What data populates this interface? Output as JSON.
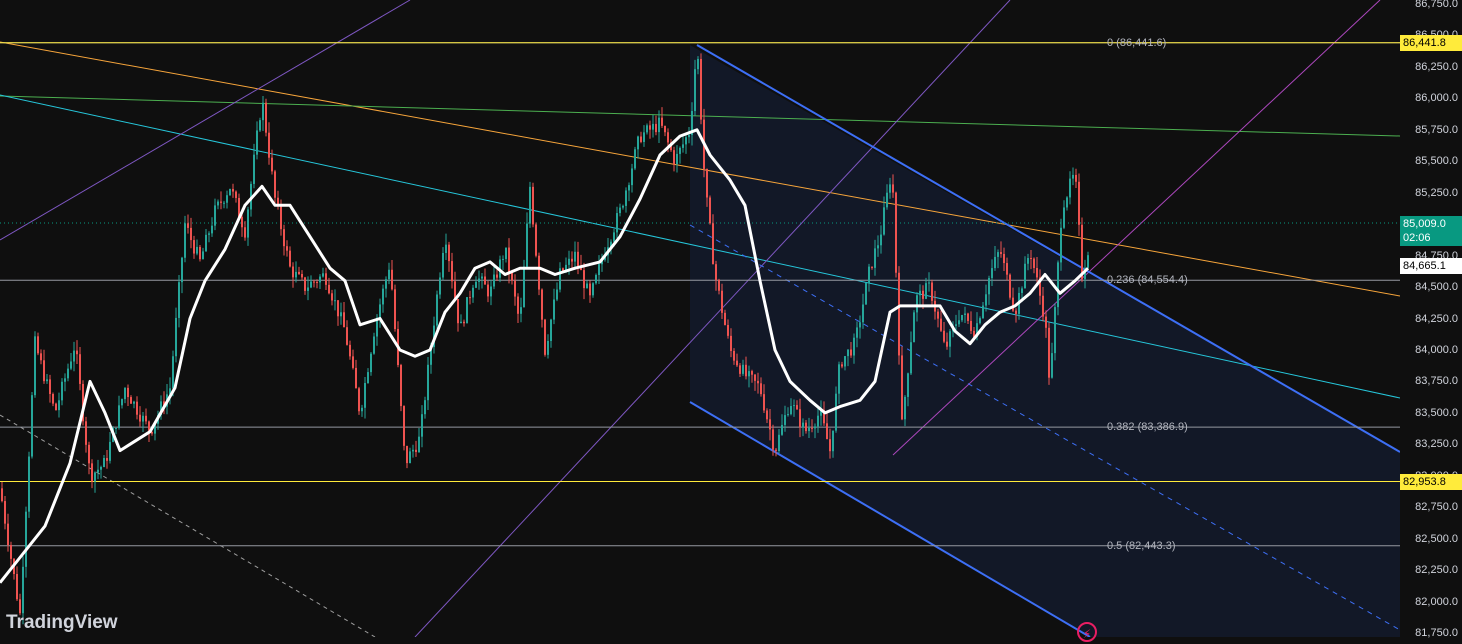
{
  "chart_data": {
    "type": "candlestick",
    "price_scale": {
      "ylim": [
        81750,
        86750
      ],
      "ticks": [
        "86,750.0",
        "86,500.0",
        "86,250.0",
        "86,000.0",
        "85,750.0",
        "85,500.0",
        "85,250.0",
        "85,000.0",
        "84,750.0",
        "84,500.0",
        "84,250.0",
        "84,000.0",
        "83,750.0",
        "83,500.0",
        "83,250.0",
        "83,000.0",
        "82,750.0",
        "82,500.0",
        "82,250.0",
        "82,000.0",
        "81,750.0"
      ]
    },
    "fib_levels": [
      {
        "label": "0 (86,441.6)",
        "value": 86441.6
      },
      {
        "label": "0.236 (84,554.4)",
        "value": 84554.4
      },
      {
        "label": "0.382 (83,386.9)",
        "value": 83386.9
      },
      {
        "label": "0.5 (82,443.3)",
        "value": 82443.3
      }
    ],
    "horizontal_lines": [
      {
        "value": 86441.8,
        "label": "86,441.8",
        "color": "#ffeb3b"
      },
      {
        "value": 82953.8,
        "label": "82,953.8",
        "color": "#ffeb3b"
      }
    ],
    "current_price": {
      "value": 85009.0,
      "label": "85,009.0",
      "countdown": "02:06",
      "color": "#089981"
    },
    "crosshair_price": {
      "value": 84665.1,
      "label": "84,665.1"
    },
    "price_path": [
      [
        0,
        82900
      ],
      [
        20,
        81900
      ],
      [
        35,
        84050
      ],
      [
        55,
        83500
      ],
      [
        75,
        84050
      ],
      [
        90,
        83000
      ],
      [
        105,
        83100
      ],
      [
        125,
        83700
      ],
      [
        150,
        83350
      ],
      [
        170,
        83700
      ],
      [
        185,
        85000
      ],
      [
        200,
        84700
      ],
      [
        215,
        85100
      ],
      [
        230,
        85300
      ],
      [
        245,
        84950
      ],
      [
        262,
        86000
      ],
      [
        275,
        85200
      ],
      [
        290,
        84650
      ],
      [
        305,
        84500
      ],
      [
        325,
        84600
      ],
      [
        345,
        84150
      ],
      [
        360,
        83500
      ],
      [
        375,
        84200
      ],
      [
        390,
        84700
      ],
      [
        405,
        83100
      ],
      [
        420,
        83300
      ],
      [
        435,
        84300
      ],
      [
        445,
        84950
      ],
      [
        460,
        84150
      ],
      [
        475,
        84600
      ],
      [
        490,
        84450
      ],
      [
        505,
        84800
      ],
      [
        520,
        84200
      ],
      [
        530,
        85300
      ],
      [
        545,
        84000
      ],
      [
        560,
        84600
      ],
      [
        575,
        84750
      ],
      [
        590,
        84400
      ],
      [
        605,
        84800
      ],
      [
        620,
        85100
      ],
      [
        640,
        85700
      ],
      [
        660,
        85800
      ],
      [
        675,
        85500
      ],
      [
        690,
        85750
      ],
      [
        697,
        86441
      ],
      [
        705,
        85300
      ],
      [
        715,
        84600
      ],
      [
        730,
        84000
      ],
      [
        745,
        83800
      ],
      [
        760,
        83700
      ],
      [
        775,
        83200
      ],
      [
        790,
        83600
      ],
      [
        805,
        83350
      ],
      [
        820,
        83500
      ],
      [
        830,
        83200
      ],
      [
        840,
        83900
      ],
      [
        855,
        84050
      ],
      [
        870,
        84650
      ],
      [
        880,
        84900
      ],
      [
        892,
        85450
      ],
      [
        902,
        83400
      ],
      [
        915,
        84400
      ],
      [
        930,
        84500
      ],
      [
        945,
        84000
      ],
      [
        960,
        84300
      ],
      [
        975,
        84150
      ],
      [
        990,
        84600
      ],
      [
        1000,
        84800
      ],
      [
        1015,
        84300
      ],
      [
        1030,
        84800
      ],
      [
        1045,
        84250
      ],
      [
        1050,
        83700
      ],
      [
        1062,
        85150
      ],
      [
        1075,
        85400
      ],
      [
        1082,
        84600
      ],
      [
        1088,
        84800
      ]
    ],
    "moving_average_path": [
      [
        0,
        82150
      ],
      [
        20,
        82350
      ],
      [
        45,
        82600
      ],
      [
        70,
        83100
      ],
      [
        90,
        83750
      ],
      [
        105,
        83500
      ],
      [
        120,
        83200
      ],
      [
        150,
        83350
      ],
      [
        175,
        83700
      ],
      [
        190,
        84250
      ],
      [
        205,
        84550
      ],
      [
        225,
        84800
      ],
      [
        245,
        85150
      ],
      [
        262,
        85300
      ],
      [
        275,
        85150
      ],
      [
        290,
        85150
      ],
      [
        310,
        84900
      ],
      [
        330,
        84650
      ],
      [
        345,
        84550
      ],
      [
        360,
        84200
      ],
      [
        380,
        84250
      ],
      [
        400,
        84000
      ],
      [
        415,
        83950
      ],
      [
        430,
        84000
      ],
      [
        445,
        84300
      ],
      [
        460,
        84450
      ],
      [
        475,
        84650
      ],
      [
        490,
        84700
      ],
      [
        505,
        84600
      ],
      [
        520,
        84650
      ],
      [
        540,
        84650
      ],
      [
        555,
        84600
      ],
      [
        575,
        84650
      ],
      [
        600,
        84700
      ],
      [
        620,
        84900
      ],
      [
        640,
        85200
      ],
      [
        660,
        85550
      ],
      [
        680,
        85700
      ],
      [
        697,
        85750
      ],
      [
        710,
        85550
      ],
      [
        730,
        85350
      ],
      [
        745,
        85150
      ],
      [
        760,
        84550
      ],
      [
        775,
        84000
      ],
      [
        790,
        83750
      ],
      [
        810,
        83600
      ],
      [
        825,
        83500
      ],
      [
        840,
        83550
      ],
      [
        860,
        83600
      ],
      [
        875,
        83750
      ],
      [
        890,
        84300
      ],
      [
        900,
        84350
      ],
      [
        920,
        84350
      ],
      [
        940,
        84350
      ],
      [
        955,
        84150
      ],
      [
        970,
        84050
      ],
      [
        985,
        84200
      ],
      [
        1000,
        84300
      ],
      [
        1015,
        84350
      ],
      [
        1030,
        84450
      ],
      [
        1045,
        84600
      ],
      [
        1060,
        84450
      ],
      [
        1075,
        84550
      ],
      [
        1088,
        84650
      ]
    ]
  },
  "branding": {
    "logo_text": "TradingView"
  }
}
